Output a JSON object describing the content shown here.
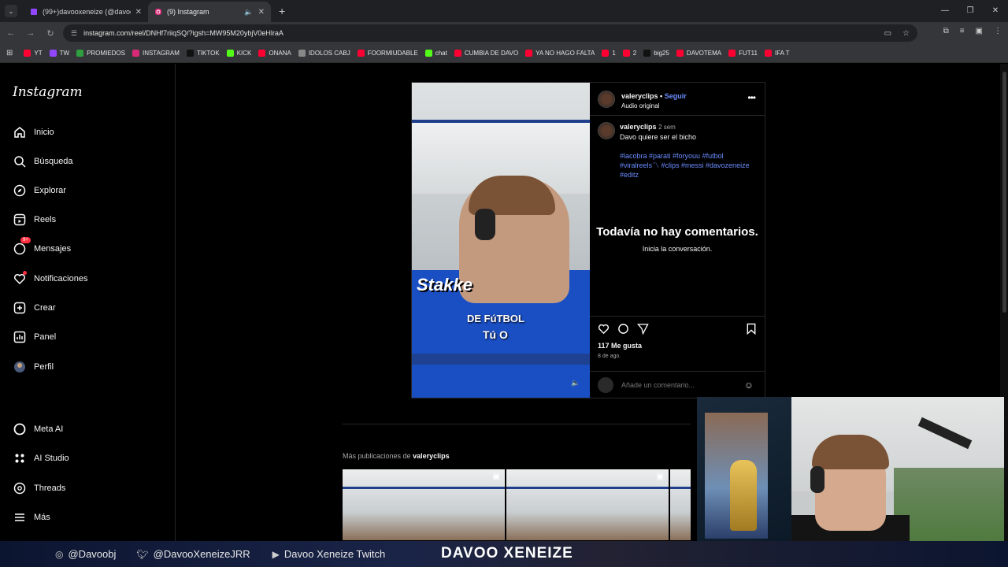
{
  "browser": {
    "tabs": [
      {
        "title": "(99+)davooxeneize (@davooxe..."
      },
      {
        "title": "(9) Instagram"
      }
    ],
    "url": "instagram.com/reel/DNHf7riiqSQ/?igsh=MW95M20ybjV0eHlraA",
    "bookmarks": [
      {
        "label": "YT",
        "color": "#ff0033"
      },
      {
        "label": "TW",
        "color": "#9146ff"
      },
      {
        "label": "PROMIEDOS",
        "color": "#2e9e3f"
      },
      {
        "label": "INSTAGRAM",
        "color": "#d62976"
      },
      {
        "label": "TIKTOK",
        "color": "#111111"
      },
      {
        "label": "KICK",
        "color": "#53fc18"
      },
      {
        "label": "ONANA",
        "color": "#ff0033"
      },
      {
        "label": "IDOLOS CABJ",
        "color": "#888888"
      },
      {
        "label": "FOORMIUDABLE",
        "color": "#ff0033"
      },
      {
        "label": "chat",
        "color": "#53fc18"
      },
      {
        "label": "CUMBIA DE DAVO",
        "color": "#ff0033"
      },
      {
        "label": "YA NO HAGO FALTA",
        "color": "#ff0033"
      },
      {
        "label": "1",
        "color": "#ff0033"
      },
      {
        "label": "2",
        "color": "#ff0033"
      },
      {
        "label": "big25",
        "color": "#111111"
      },
      {
        "label": "DAVOTEMA",
        "color": "#ff0033"
      },
      {
        "label": "FUT11",
        "color": "#ff0033"
      },
      {
        "label": "IFA T",
        "color": "#ff0033"
      }
    ]
  },
  "sidebar": {
    "logo": "Instagram",
    "items": [
      {
        "label": "Inicio"
      },
      {
        "label": "Búsqueda"
      },
      {
        "label": "Explorar"
      },
      {
        "label": "Reels"
      },
      {
        "label": "Mensajes",
        "badge": "9+"
      },
      {
        "label": "Notificaciones"
      },
      {
        "label": "Crear"
      },
      {
        "label": "Panel"
      },
      {
        "label": "Perfil"
      },
      {
        "label": "Meta AI"
      },
      {
        "label": "AI Studio"
      },
      {
        "label": "Threads"
      },
      {
        "label": "Más"
      }
    ]
  },
  "post": {
    "username": "valeryclips",
    "follow": "Seguir",
    "audio": "Audio original",
    "caption_time": "2 sem",
    "caption": "Davo quiere ser el bicho",
    "hashtags": "#lacobra #parati #foryouu #futbol #viralreels〽 #clips #messi #davozeneize #editz",
    "no_comments": "Todavía no hay comentarios.",
    "start_convo": "Inicia la conversación.",
    "likes": "117 Me gusta",
    "date": "8 de ago.",
    "comment_placeholder": "Añade un comentario...",
    "video_overlay": {
      "stakke": "Stakke",
      "line1": "DE FúTBOL",
      "line2": "Tú O"
    }
  },
  "more": {
    "prefix": "Más publicaciones de",
    "user": "valeryclips"
  },
  "stream": {
    "ig": "@Davoobj",
    "tw": "@DavooXeneizeJRR",
    "yt": "Davoo Xeneize Twitch",
    "brand": "DAVOO XENEIZE"
  }
}
